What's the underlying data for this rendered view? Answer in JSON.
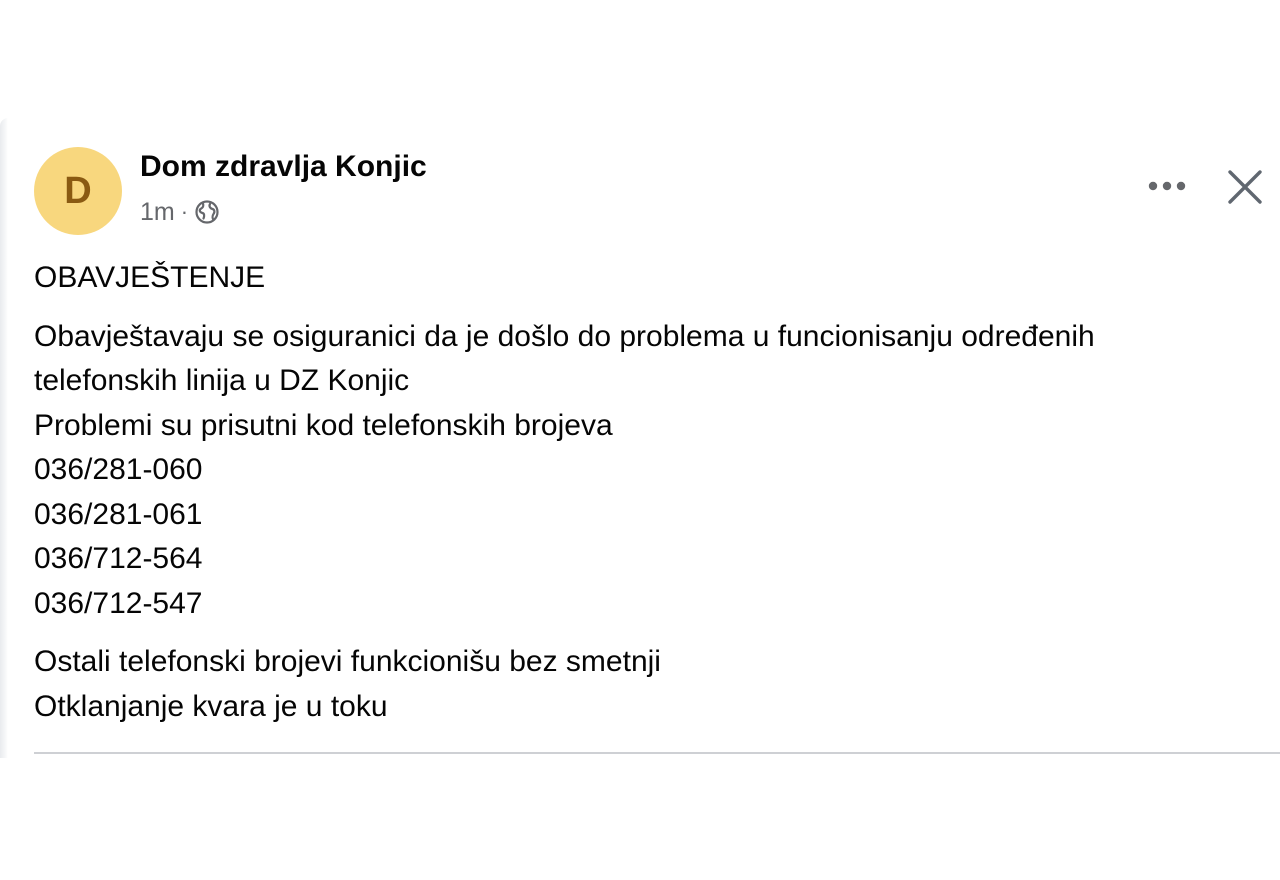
{
  "post": {
    "author": {
      "name": "Dom zdravlja Konjic",
      "avatar_initial": "D",
      "avatar_color": "#f8d77e"
    },
    "meta": {
      "timestamp": "1m",
      "separator": "·",
      "audience_icon": "globe-icon"
    },
    "actions": {
      "more_icon": "more-horizontal-icon",
      "close_icon": "close-icon"
    },
    "body": {
      "heading": "OBAVJEŠTENJE",
      "paragraph1_line1": "Obavještavaju se osiguranici da je došlo do problema u funcionisanju određenih",
      "paragraph1_line2": "telefonskih linija u DZ Konjic",
      "paragraph1_line3": "Problemi su prisutni kod telefonskih brojeva",
      "phone_numbers": [
        "036/281-060",
        "036/281-061",
        "036/712-564",
        "036/712-547"
      ],
      "paragraph2_line1": "Ostali telefonski brojevi funkcionišu bez smetnji",
      "paragraph2_line2": "Otklanjanje kvara je u toku"
    }
  }
}
